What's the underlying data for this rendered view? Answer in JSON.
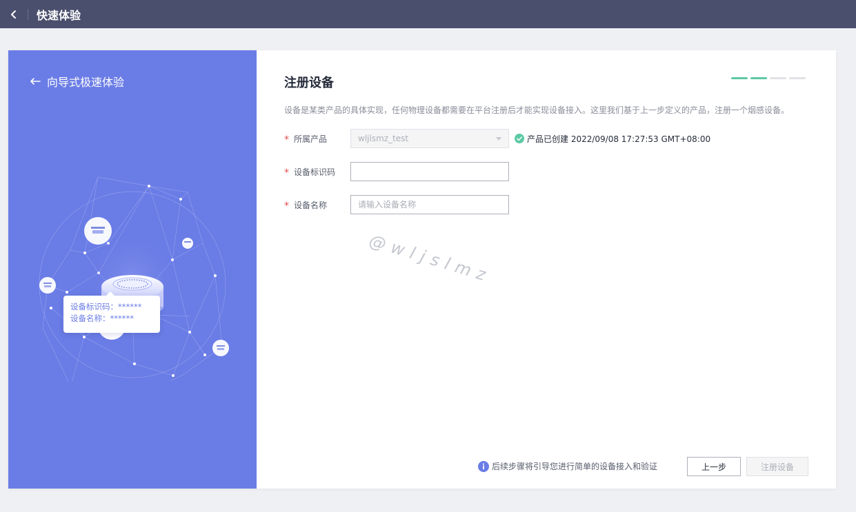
{
  "header": {
    "title": "快速体验"
  },
  "left_panel": {
    "back_label": "向导式极速体验",
    "tooltip": {
      "line1": "设备标识码：******",
      "line2": "设备名称：******"
    }
  },
  "form": {
    "title": "注册设备",
    "steps": [
      {
        "state": "done",
        "color": "#5cc9a5"
      },
      {
        "state": "done",
        "color": "#5cc9a5"
      },
      {
        "state": "todo",
        "color": "#e1e2e6"
      },
      {
        "state": "todo",
        "color": "#e1e2e6"
      }
    ],
    "description": "设备是某类产品的具体实现，任何物理设备都需要在平台注册后才能实现设备接入。这里我们基于上一步定义的产品，注册一个烟感设备。",
    "fields": {
      "product": {
        "required_mark": "*",
        "label": "所属产品",
        "value": "wljlsmz_test",
        "created_text": "产品已创建 2022/09/08 17:27:53 GMT+08:00"
      },
      "device_id": {
        "required_mark": "*",
        "label": "设备标识码",
        "value": "",
        "placeholder": ""
      },
      "device_name": {
        "required_mark": "*",
        "label": "设备名称",
        "value": "",
        "placeholder": "请输入设备名称"
      }
    }
  },
  "watermark": "@wljslmz",
  "footer": {
    "note": "后续步骤将引导您进行简单的设备接入和验证",
    "prev_button": "上一步",
    "register_button": "注册设备"
  },
  "colors": {
    "topbar": "#4a4f6d",
    "panel": "#6a7ce5",
    "success": "#5cc9a5",
    "info": "#6a7ce5"
  }
}
